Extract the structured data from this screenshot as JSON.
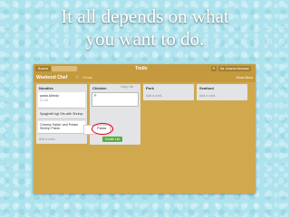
{
  "slide": {
    "title_line1": "It all depends on what",
    "title_line2": "you want to do."
  },
  "topbar": {
    "boards_label": "Boards",
    "logo_text": "Trello",
    "add_symbol": "+",
    "user_name": "Ms. Amanda Beckman"
  },
  "board": {
    "title": "Weekend Chef",
    "star_icon": "star-icon",
    "visibility": "Private",
    "menu_label": "Show Menu"
  },
  "lists": [
    {
      "title": "Noodles",
      "cards": [
        {
          "text": "pasta Alfredo",
          "meta": "☑ 1/3"
        },
        {
          "text": "Spaghetti bgf Ots with Shrimp"
        },
        {
          "text": "Creamy Salad, and Potato Shrimp Pasta"
        }
      ],
      "add_card": "Add a card..."
    },
    {
      "title": "Chicken",
      "composer_value": "P",
      "composer_placeholder": "",
      "autocomplete_option": "Pasta",
      "add_button": "Create List",
      "close_symbol": "×"
    },
    {
      "title": "Pork",
      "add_card": "Add a card..."
    },
    {
      "title": "Seafood",
      "add_card": "Add a card..."
    }
  ],
  "copy_link": "Copy List"
}
